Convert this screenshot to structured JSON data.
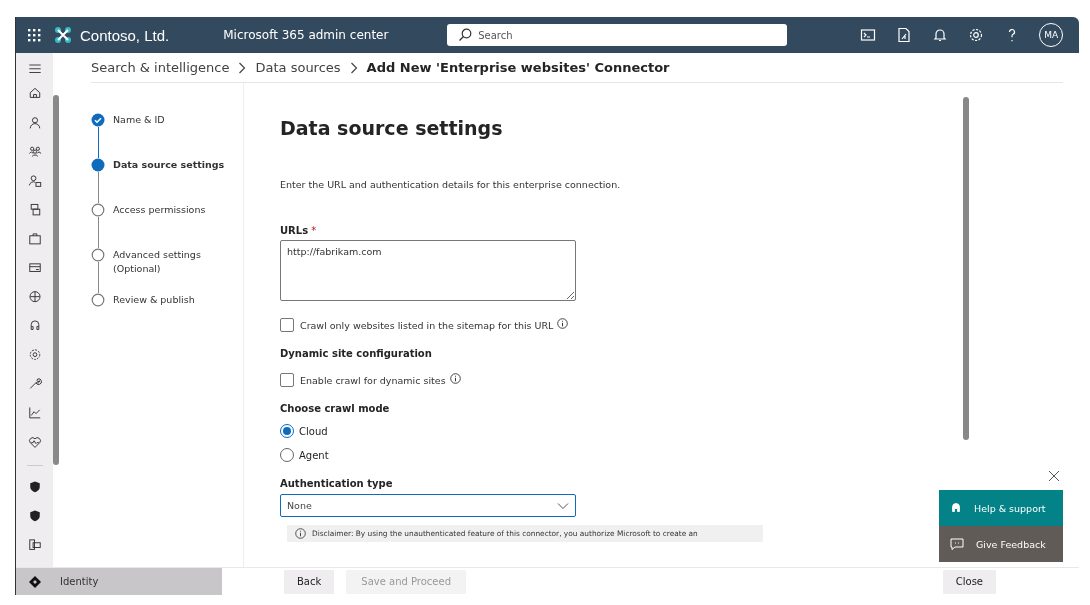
{
  "top_bar": {
    "org_name": "Contoso, Ltd.",
    "app_title": "Microsoft 365 admin center",
    "search": {
      "placeholder": "Search"
    },
    "avatar": "MA"
  },
  "breadcrumb": [
    {
      "label": "Search & intelligence",
      "current": false
    },
    {
      "label": "Data sources",
      "current": false
    },
    {
      "label": "Add New 'Enterprise websites' Connector",
      "current": true
    }
  ],
  "steps": [
    {
      "label": "Name & ID",
      "completed": true,
      "selected": false
    },
    {
      "label": "Data source settings",
      "completed": false,
      "selected": true
    },
    {
      "label": "Access permissions",
      "completed": false,
      "selected": false
    },
    {
      "label": "Advanced settings (Optional)",
      "completed": false,
      "selected": false
    },
    {
      "label": "Review & publish",
      "completed": false,
      "selected": false
    }
  ],
  "form": {
    "title": "Data source settings",
    "description": "Enter the URL and authentication details for this enterprise connection.",
    "urls": {
      "label": "URLs",
      "required_mark": "*",
      "value": "http://fabrikam.com"
    },
    "sitemap_checkbox": {
      "label": "Crawl only websites listed in the sitemap for this URL",
      "checked": false
    },
    "dynamic_heading": "Dynamic site configuration",
    "dynamic_checkbox": {
      "label": "Enable crawl for dynamic sites",
      "checked": false
    },
    "crawl_mode_heading": "Choose crawl mode",
    "crawl_modes": [
      {
        "label": "Cloud",
        "selected": true
      },
      {
        "label": "Agent",
        "selected": false
      }
    ],
    "auth_heading": "Authentication type",
    "auth_select": {
      "value": "None"
    },
    "disclaimer": "Disclaimer: By using the unauthenticated feature of this connector, you authorize Microsoft to create an"
  },
  "footer": {
    "nav_item": "Identity",
    "buttons": [
      {
        "label": "Back",
        "disabled": false
      },
      {
        "label": "Save and Proceed",
        "disabled": true
      }
    ],
    "close_button": "Close"
  },
  "help_panel": {
    "items": [
      {
        "label": "Help & support",
        "kind": "help"
      },
      {
        "label": "Give Feedback",
        "kind": "feedback"
      }
    ]
  }
}
